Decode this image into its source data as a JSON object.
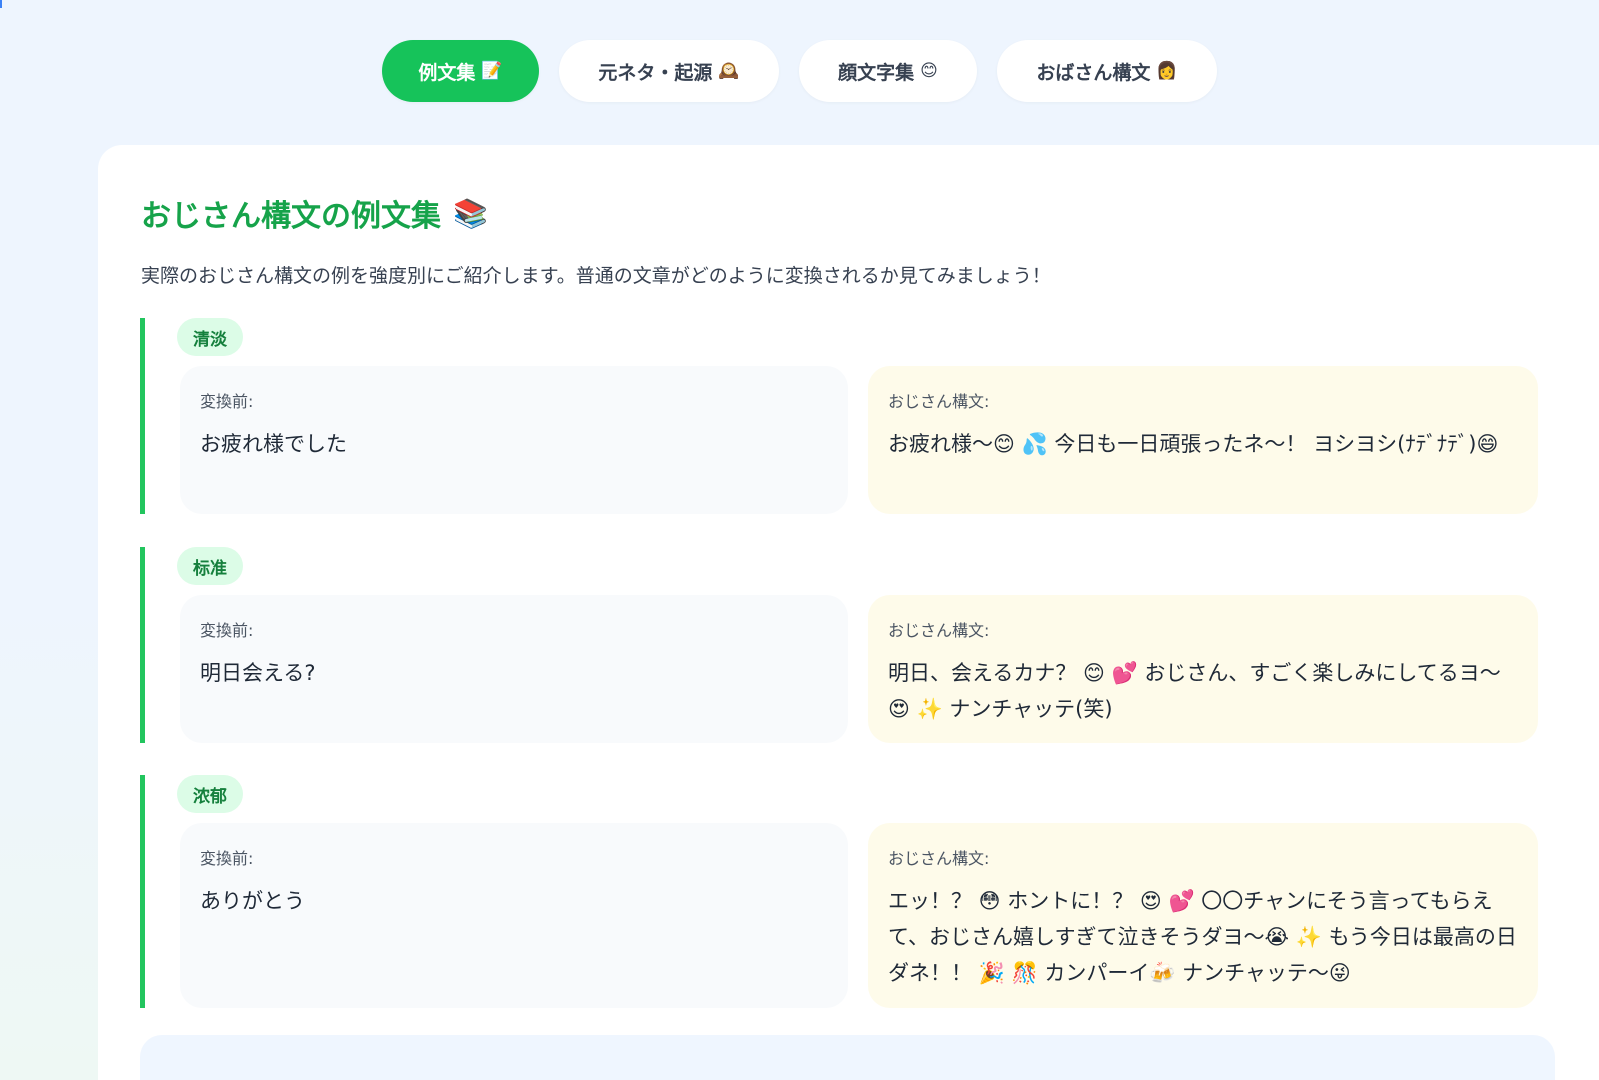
{
  "tabs": [
    {
      "label": "例文集",
      "icon": "📝",
      "active": true
    },
    {
      "label": "元ネタ・起源",
      "icon": "🕰️",
      "active": false
    },
    {
      "label": "顔文字集",
      "icon": "😊",
      "active": false
    },
    {
      "label": "おばさん構文",
      "icon": "👩",
      "active": false
    }
  ],
  "section": {
    "title": "おじさん構文の例文集",
    "title_icon": "📚",
    "intro": "実際のおじさん構文の例を強度別にご紹介します。普通の文章がどのように変換されるか見てみましょう！"
  },
  "examples": [
    {
      "level": "清淡",
      "before_label": "変換前:",
      "before_text": "お疲れ様でした",
      "after_label": "おじさん構文:",
      "after_text": "お疲れ様〜😊 💦 今日も一日頑張ったネ〜！ ヨシヨシ(ﾅﾃﾞﾅﾃﾞ)😄"
    },
    {
      "level": "标准",
      "before_label": "変換前:",
      "before_text": "明日会える?",
      "after_label": "おじさん構文:",
      "after_text": "明日、会えるカナ？ 😊 💕 おじさん、すごく楽しみにしてるヨ〜😍 ✨ ナンチャッテ(笑)"
    },
    {
      "level": "浓郁",
      "before_label": "変換前:",
      "before_text": "ありがとう",
      "after_label": "おじさん構文:",
      "after_text": "エッ！？ 😳 ホントに！？ 😍 💕 〇〇チャンにそう言ってもらえて、おじさん嬉しすぎて泣きそうダヨ〜😭 ✨ もう今日は最高の日ダネ！！ 🎉 🎊 カンパーイ🍻 ナンチャッテ〜😜"
    }
  ],
  "colors": {
    "accent": "#16c35a",
    "title": "#16a34a",
    "badge_bg": "#dcfce7",
    "before_bg": "#f8fafc",
    "after_bg": "#fefbea"
  }
}
